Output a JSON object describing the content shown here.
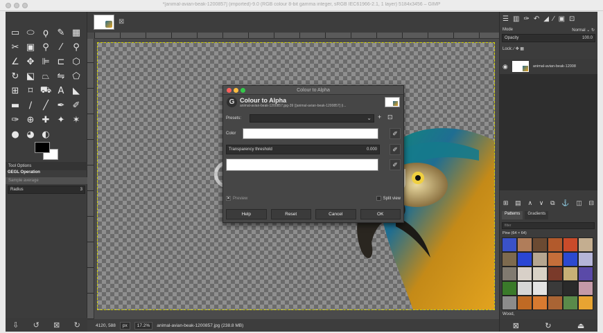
{
  "window": {
    "title": "*[animal-avian-beak-1200857] (imported)-9.0 (RGB colour 8-bit gamma integer, sRGB IEC61966-2.1, 1 layer) 5184x3456 – GIMP"
  },
  "toolbox": {
    "tools": [
      {
        "icon": "rect-select-icon",
        "glyph": "▭"
      },
      {
        "icon": "ellipse-select-icon",
        "glyph": "⬭"
      },
      {
        "icon": "free-select-icon",
        "glyph": "ϙ"
      },
      {
        "icon": "fuzzy-select-icon",
        "glyph": "✎"
      },
      {
        "icon": "by-color-select-icon",
        "glyph": "▦"
      },
      {
        "icon": "scissors-icon",
        "glyph": "✂"
      },
      {
        "icon": "foreground-select-icon",
        "glyph": "▣"
      },
      {
        "icon": "paths-icon",
        "glyph": "⚲"
      },
      {
        "icon": "color-picker-icon",
        "glyph": "⁄"
      },
      {
        "icon": "zoom-icon",
        "glyph": "⚲"
      },
      {
        "icon": "measure-icon",
        "glyph": "∠"
      },
      {
        "icon": "move-icon",
        "glyph": "✥"
      },
      {
        "icon": "align-icon",
        "glyph": "⊫"
      },
      {
        "icon": "crop-icon",
        "glyph": "⊏"
      },
      {
        "icon": "unified-transform-icon",
        "glyph": "⬡"
      },
      {
        "icon": "rotate-icon",
        "glyph": "↻"
      },
      {
        "icon": "shear-icon",
        "glyph": "⬕"
      },
      {
        "icon": "perspective-icon",
        "glyph": "⏢"
      },
      {
        "icon": "flip-icon",
        "glyph": "⇋"
      },
      {
        "icon": "cage-icon",
        "glyph": "⬠"
      },
      {
        "icon": "warp-icon",
        "glyph": "⊞"
      },
      {
        "icon": "handle-transform-icon",
        "glyph": "⌑"
      },
      {
        "icon": "bucket-fill-icon",
        "glyph": "⛟"
      },
      {
        "icon": "text-icon",
        "glyph": "A"
      },
      {
        "icon": "gradient-icon",
        "glyph": "◣"
      },
      {
        "icon": "pencil-icon",
        "glyph": "▬"
      },
      {
        "icon": "paintbrush-icon",
        "glyph": "∕"
      },
      {
        "icon": "eraser-icon",
        "glyph": "╱"
      },
      {
        "icon": "airbrush-icon",
        "glyph": "✒"
      },
      {
        "icon": "ink-icon",
        "glyph": "✐"
      },
      {
        "icon": "mypaint-brush-icon",
        "glyph": "✑"
      },
      {
        "icon": "clone-icon",
        "glyph": "⊕"
      },
      {
        "icon": "heal-icon",
        "glyph": "✚"
      },
      {
        "icon": "perspective-clone-icon",
        "glyph": "✦"
      },
      {
        "icon": "blur-icon",
        "glyph": "✶"
      },
      {
        "icon": "smudge-icon",
        "glyph": "●"
      },
      {
        "icon": "dodge-burn-icon",
        "glyph": "◕"
      },
      {
        "icon": "color-tool-icon",
        "glyph": "◐"
      }
    ],
    "tool_options_label": "Tool Options",
    "gegl_title": "GEGL Operation",
    "sample_average": "Sample average",
    "radius_label": "Radius",
    "radius_value": "3"
  },
  "image": {
    "tab_close": "⊠",
    "watermark": "uantrimang",
    "status": {
      "coords": "4120, 588",
      "unit": "px",
      "zoom": "17.2%",
      "filename": "animal-avian-beak-1200857.jpg (238.8 MB)"
    }
  },
  "dialog": {
    "window_title": "Colour to Alpha",
    "heading": "Colour to Alpha",
    "subheading": "animal-avian-beak-1200857.jpg-39 ([animal-avian-beak-1200857] (i...",
    "presets_label": "Presets:",
    "color_label": "Color",
    "threshold_label": "Transparency threshold",
    "threshold_value": "0.000",
    "preview_label": "Preview",
    "split_view_label": "Split view",
    "buttons": {
      "help": "Help",
      "reset": "Reset",
      "cancel": "Cancel",
      "ok": "OK"
    }
  },
  "dock": {
    "mode_label": "Mode",
    "mode_value": "Normal",
    "opacity_label": "Opacity",
    "opacity_value": "100.0",
    "lock_label": "Lock:",
    "layer_name": "animal-avian-beak-12008",
    "tabs": {
      "patterns": "Patterns",
      "gradients": "Gradients"
    },
    "filter_placeholder": "filter",
    "pattern_title": "Pine (64 × 64)",
    "pattern_footer": "Wood,",
    "pattern_colors": [
      "#3a52c8",
      "#b07d5a",
      "#6b4a32",
      "#b25a2c",
      "#c94b2a",
      "#c4ae90",
      "#7d6a4e",
      "#2a46d4",
      "#b6a690",
      "#c56e3a",
      "#2d49cf",
      "#b5b5d8",
      "#807a70",
      "#d8d0c8",
      "#d9d2c6",
      "#7a3a2a",
      "#c8b076",
      "#5a4aa8",
      "#3a7a2a",
      "#d6d6d6",
      "#e4e4e4",
      "#3a3a3a",
      "#2a2a2a",
      "#c49aa8",
      "#8c8c8c",
      "#c06a24",
      "#d87a30",
      "#a96434",
      "#5a8a4a",
      "#e8a432"
    ]
  }
}
